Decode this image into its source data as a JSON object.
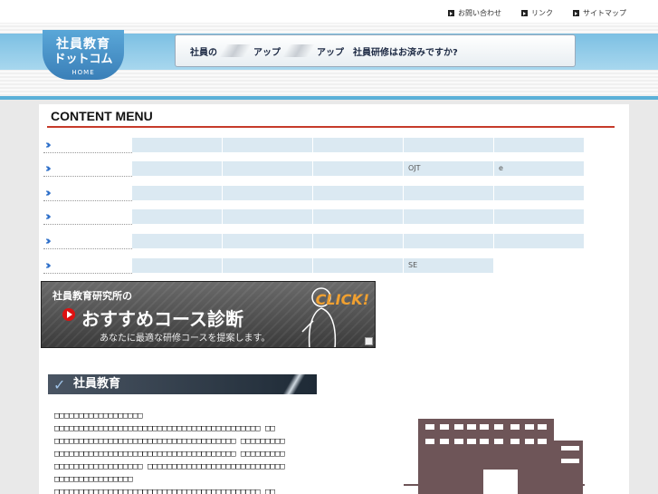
{
  "header": {
    "utility_links": [
      "お問い合わせ",
      "リンク",
      "サイトマップ"
    ],
    "logo": {
      "line1": "社員教育",
      "line2": "ドットコム",
      "home_label": "HOME"
    },
    "slogan": [
      "社員の",
      "アップ",
      "アップ",
      "社員研修はお済みですか?"
    ]
  },
  "content_menu": {
    "title": "CONTENT MENU",
    "rows": [
      [
        "",
        "",
        "",
        "",
        ""
      ],
      [
        "",
        "",
        "",
        "OJT",
        "e"
      ],
      [
        "",
        "",
        "",
        "",
        ""
      ],
      [
        "",
        "",
        "",
        "",
        ""
      ],
      [
        "",
        "",
        "",
        "",
        ""
      ],
      [
        "",
        "",
        "",
        "SE"
      ]
    ]
  },
  "banner": {
    "line1": "社員教育研究所の",
    "line2": "おすすめコース診断",
    "line3": "あなたに最適な研修コースを提案します。",
    "click": "CLICK!"
  },
  "section": {
    "heading": "社員教育",
    "text_lines": [
      "□□□□□□□□□□□□□□□□□□",
      "□□□□□□□□□□□□□□□□□□□□□□□□□□□□□□□□□□□□□□□□□□ □□",
      "□□□□□□□□□□□□□□□□□□□□□□□□□□□□□□□□□□□□□ □□□□□□□□□",
      "□□□□□□□□□□□□□□□□□□□□□□□□□□□□□□□□□□□□□ □□□□□□□□□",
      "□□□□□□□□□□□□□□□□□□ □□□□□□□□□□□□□□□□□□□□□□□□□□□□",
      "□□□□□□□□□□□□□□□□",
      "□□□□□□□□□□□□□□□□□□□□□□□□□□□□□□□□□□□□□□□□□□ □□"
    ]
  },
  "colors": {
    "accent_blue": "#5bb0d8",
    "menu_rule": "#c63a2a",
    "cell_bg": "#dbe9f2",
    "chevron": "#2c6ec9"
  }
}
